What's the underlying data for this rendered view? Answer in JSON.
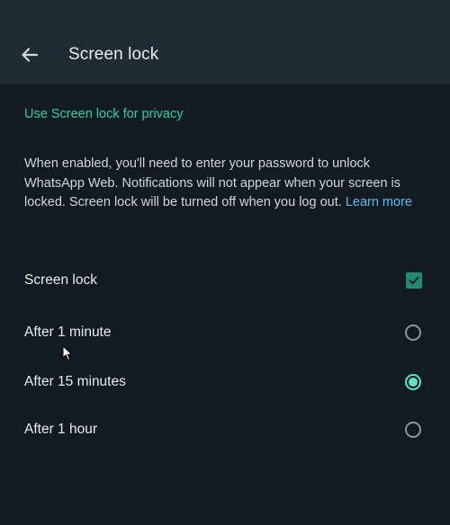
{
  "header": {
    "title": "Screen lock",
    "back_icon": "arrow-left-icon"
  },
  "section": {
    "title": "Use Screen lock for privacy"
  },
  "description": {
    "text": "When enabled, you'll need to enter your password to unlock WhatsApp Web. Notifications will not appear when your screen is locked. Screen lock will be turned off when you log out. ",
    "link": "Learn more"
  },
  "screen_lock": {
    "label": "Screen lock",
    "checked": true,
    "checkbox_color": "#1d8c6f"
  },
  "timeouts": [
    {
      "label": "After 1 minute",
      "selected": false
    },
    {
      "label": "After 15 minutes",
      "selected": true
    },
    {
      "label": "After 1 hour",
      "selected": false
    }
  ],
  "colors": {
    "accent": "#25d0a8",
    "link": "#53bdeb",
    "radio_selected": "#5fe3c2",
    "background": "#111b21",
    "header": "#202c33"
  }
}
